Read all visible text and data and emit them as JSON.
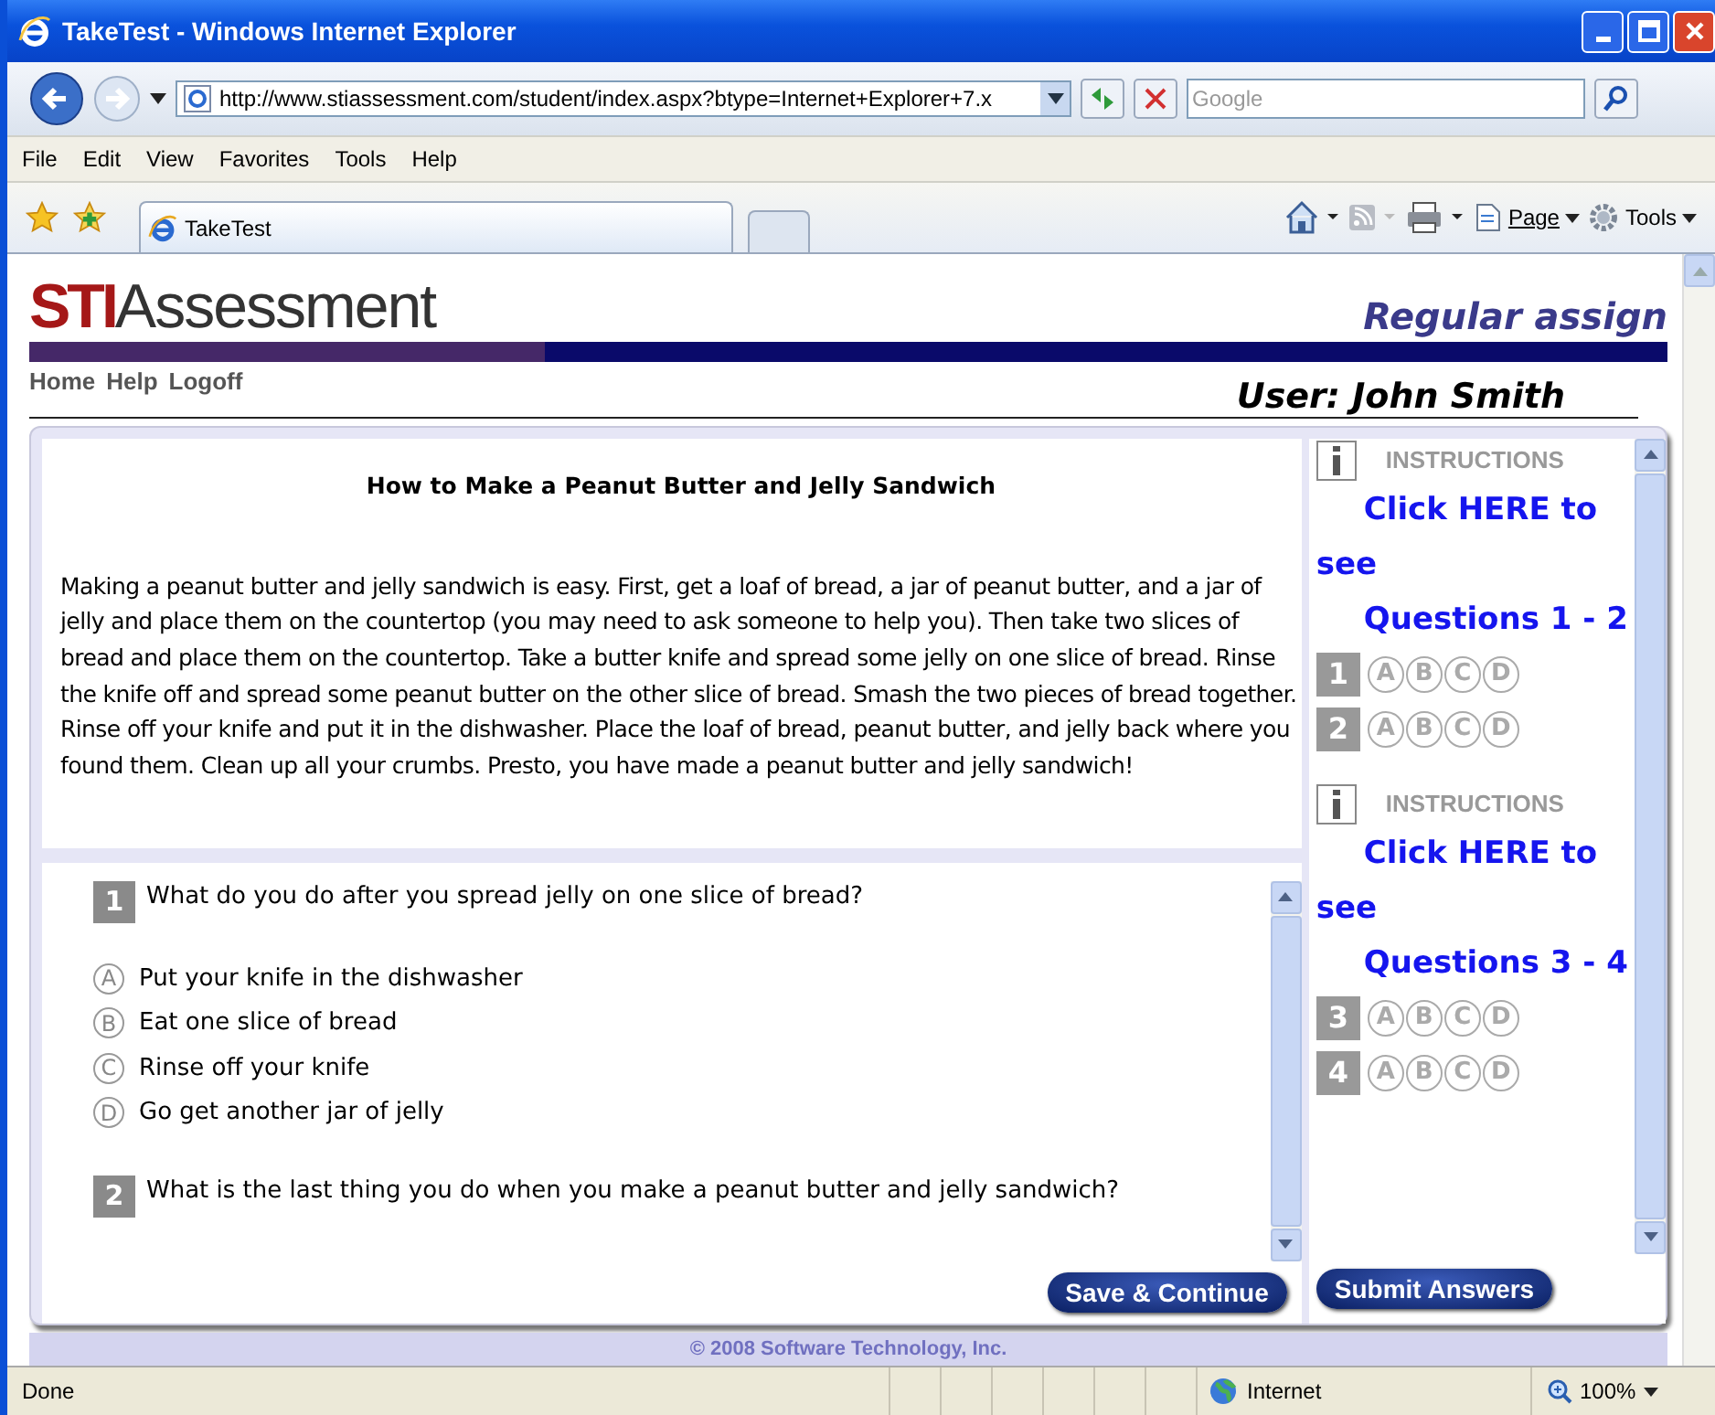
{
  "window": {
    "title": "TakeTest - Windows Internet Explorer"
  },
  "address_bar": {
    "url": "http://www.stiassessment.com/student/index.aspx?btype=Internet+Explorer+7.x"
  },
  "search": {
    "placeholder": "Google"
  },
  "menu": [
    "File",
    "Edit",
    "View",
    "Favorites",
    "Tools",
    "Help"
  ],
  "tabs": [
    {
      "label": "TakeTest",
      "selected": true
    }
  ],
  "toolbar": [
    {
      "kind": "home"
    },
    {
      "kind": "feeds"
    },
    {
      "kind": "print"
    },
    {
      "kind": "page",
      "label": "Page"
    },
    {
      "kind": "tools",
      "label": "Tools"
    }
  ],
  "site": {
    "logo_bold": "STI",
    "logo_rest": "Assessment",
    "assignment": "Regular assign",
    "nav": [
      "Home",
      "Help",
      "Logoff"
    ],
    "user": "User: John Smith"
  },
  "passage": {
    "title": "How to Make a Peanut Butter and Jelly Sandwich",
    "text": "Making a peanut butter and jelly sandwich is easy. First, get a loaf of bread, a jar of peanut butter, and a jar of jelly and place them on the countertop (you may need to ask someone to help you). Then take two slices of bread and place them on the countertop. Take a butter knife and spread some jelly on one slice of bread. Rinse the knife off and spread some peanut butter on the other slice of bread. Smash the two pieces of bread together. Rinse off your knife and put it in the dishwasher. Place the loaf of bread, peanut butter, and jelly back where you found them. Clean up all your crumbs. Presto, you have made a peanut butter and jelly sandwich!"
  },
  "questions": [
    {
      "number": "1",
      "text": "What do you do after you spread jelly on one slice of bread?",
      "choices": [
        {
          "letter": "A",
          "text": "Put your knife in the dishwasher"
        },
        {
          "letter": "B",
          "text": "Eat one slice of bread"
        },
        {
          "letter": "C",
          "text": "Rinse off your knife"
        },
        {
          "letter": "D",
          "text": "Go get another jar of jelly"
        }
      ]
    },
    {
      "number": "2",
      "text": "What is the last thing you do when you make a peanut butter and jelly sandwich?"
    }
  ],
  "sidebar": [
    {
      "heading": "INSTRUCTIONS",
      "link": [
        "Click HERE to see",
        "Questions 1 - 2"
      ],
      "items": [
        {
          "number": "1",
          "choices": [
            "A",
            "B",
            "C",
            "D"
          ]
        },
        {
          "number": "2",
          "choices": [
            "A",
            "B",
            "C",
            "D"
          ]
        }
      ]
    },
    {
      "heading": "INSTRUCTIONS",
      "link": [
        "Click HERE to see",
        "Questions 3 - 4"
      ],
      "items": [
        {
          "number": "3",
          "choices": [
            "A",
            "B",
            "C",
            "D"
          ]
        },
        {
          "number": "4",
          "choices": [
            "A",
            "B",
            "C",
            "D"
          ]
        }
      ]
    }
  ],
  "buttons": [
    "Save & Continue",
    "Submit Answers"
  ],
  "footer": "© 2008 Software Technology, Inc.",
  "status_bar": {
    "text": "Done",
    "zone": "Internet",
    "zoom": "100%"
  }
}
